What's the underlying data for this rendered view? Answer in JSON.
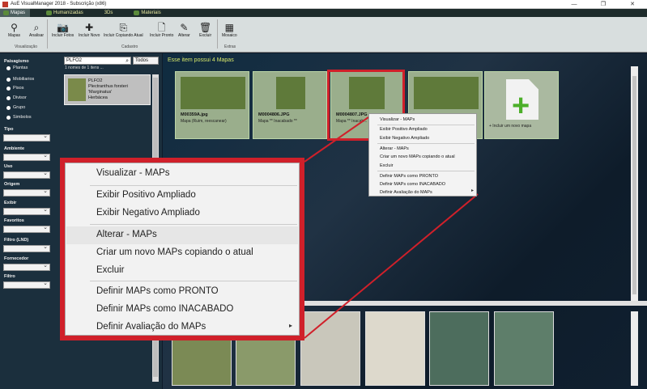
{
  "window": {
    "title": "AuE VisualManager 2018 - Subscrição (x86)",
    "controls": [
      "—",
      "❐",
      "✕"
    ]
  },
  "tabs": [
    {
      "label": "Mapas",
      "active": true
    },
    {
      "label": "Humanizadas",
      "active": false
    },
    {
      "label": "3Ds",
      "active": false
    },
    {
      "label": "Materiais",
      "active": false
    }
  ],
  "ribbon": {
    "buttons": [
      {
        "label": "Mapas",
        "icon": "⚲"
      },
      {
        "label": "Analisar",
        "icon": "⌕"
      },
      {
        "label": "Incluir Fotos",
        "icon": "📷"
      },
      {
        "label": "Incluir Novo",
        "icon": "✚"
      },
      {
        "label": "Incluir Copiando Atual",
        "icon": "⎘"
      },
      {
        "label": "Incluir Pronto",
        "icon": "🗋"
      },
      {
        "label": "Alterar",
        "icon": "✎"
      },
      {
        "label": "Excluir",
        "icon": "🗑"
      },
      {
        "label": "Mosaico",
        "icon": "▦"
      }
    ],
    "groups": [
      "Visualização",
      "Cadastro",
      "Extras"
    ]
  },
  "sidebar": {
    "paisagismo_label": "Paisagismo",
    "paisagismo_options": [
      "Plantas",
      "Mobiliarios",
      "Pisos",
      "Divisor",
      "Grupo",
      "Simbolos"
    ],
    "filters": [
      "Tipo",
      "Ambiente",
      "Uso",
      "Origem",
      "Exibir",
      "Favoritos",
      "Filtro (LND)",
      "Fornecedor",
      "Filtro"
    ]
  },
  "search": {
    "value": "PLFO2",
    "filter": "Todos",
    "count": "1 nomes de 1 itens ..."
  },
  "plant": {
    "code": "PLFO2",
    "line1": "Plectranthus forsteri",
    "line2": "'Marginatus'",
    "line3": "Herbácea"
  },
  "main": {
    "header": "Esse item possui  4 Mapas",
    "maps": [
      {
        "name": "M00359A.jpg",
        "desc": "Mapa (Ruim, reescanear)"
      },
      {
        "name": "M0004806.JPG",
        "desc": "Mapa ** Inacabado **"
      },
      {
        "name": "M0004807.JPG",
        "desc": "Mapa ** Inacab..."
      },
      {
        "name": "",
        "desc": ""
      }
    ],
    "add_label": "+ Incluir um novo mapa"
  },
  "context_menu": {
    "items": [
      {
        "label": "Visualizar - MAPs"
      },
      {
        "label": "Exibir Positivo Ampliado"
      },
      {
        "label": "Exibir Negativo Ampliado"
      },
      {
        "label": "Alterar - MAPs"
      },
      {
        "label": "Criar um novo MAPs copiando o atual"
      },
      {
        "label": "Excluir"
      },
      {
        "label": "Definir MAPs como PRONTO"
      },
      {
        "label": "Definir MAPs como INACABADO"
      },
      {
        "label": "Definir Avaliação do MAPs"
      }
    ],
    "submenu_arrow": "▸"
  },
  "colors": {
    "highlight": "#d0202a",
    "header_text": "#d8e86a"
  }
}
